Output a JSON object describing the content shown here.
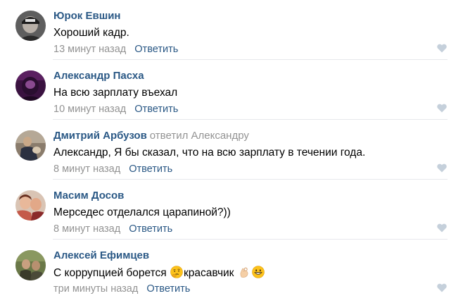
{
  "comments": [
    {
      "author": "Юрок Евшин",
      "reply_to": "",
      "text": "Хороший кадр.",
      "time": "13 минут назад",
      "reply_label": "Ответить",
      "avatar_colors": [
        "#4a4a4a",
        "#c8c8c8",
        "#1e1e1e"
      ]
    },
    {
      "author": "Александр Пасха",
      "reply_to": "",
      "text": "На всю зарплату въехал",
      "time": "10 минут назад",
      "reply_label": "Ответить",
      "avatar_colors": [
        "#3a1240",
        "#7a3a80",
        "#b06ab0"
      ]
    },
    {
      "author": "Дмитрий Арбузов",
      "reply_to": "ответил Александру",
      "text": "Александр, Я бы сказал, что на всю зарплату в течении года.",
      "time": "8 минут назад",
      "reply_label": "Ответить",
      "avatar_colors": [
        "#7a6a5a",
        "#2b3040",
        "#c9b9a4"
      ]
    },
    {
      "author": "Масим Досов",
      "reply_to": "",
      "text": "Мерседес отделался царапиной?))",
      "time": "8 минут назад",
      "reply_label": "Ответить",
      "avatar_colors": [
        "#c45a4a",
        "#e8b89a",
        "#8a2a2a"
      ]
    },
    {
      "author": "Алексей Ефимцев",
      "reply_to": "",
      "text_parts": [
        "С коррупцией борется ",
        "красавчик "
      ],
      "emojis": [
        "thinking-face-emoji",
        "ok-hand-emoji",
        "grinning-face-emoji"
      ],
      "time": "три минуты назад",
      "reply_label": "Ответить",
      "avatar_colors": [
        "#5a6a3a",
        "#3a3a2a",
        "#c8b088"
      ]
    }
  ],
  "colors": {
    "author": "#2a5885",
    "meta": "#939393",
    "divider": "#e7e8ec",
    "like_icon": "#c5d0db"
  }
}
